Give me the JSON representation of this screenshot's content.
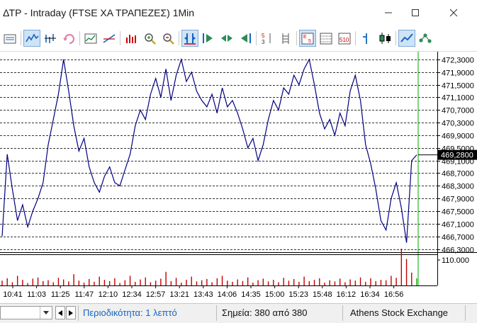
{
  "window": {
    "title": "ΔΤΡ - Intraday (FTSE ΧΑ ΤΡΑΠΕΖΕΣ) 1Min",
    "controls": [
      "minimize-icon",
      "maximize-icon",
      "close-icon"
    ]
  },
  "toolbar": {
    "buttons": [
      {
        "icon": "properties-icon",
        "selected": false
      },
      {
        "icon": "line-chart-icon",
        "selected": true
      },
      {
        "icon": "bar-chart-icon",
        "selected": false
      },
      {
        "icon": "refresh-icon",
        "selected": false
      },
      {
        "icon": "indicator-icon",
        "selected": false
      },
      {
        "icon": "trend-tool-icon",
        "selected": false
      },
      {
        "icon": "volume-bars-icon",
        "selected": false
      },
      {
        "icon": "zoom-in-icon",
        "selected": false
      },
      {
        "icon": "zoom-out-icon",
        "selected": false
      },
      {
        "icon": "fit-icon",
        "selected": true
      },
      {
        "icon": "scroll-end-icon",
        "selected": false
      },
      {
        "icon": "scroll-both-icon",
        "selected": false
      },
      {
        "icon": "scroll-start-icon",
        "selected": false
      },
      {
        "icon": "sort-descending-icon",
        "selected": false
      },
      {
        "icon": "ladder-icon",
        "selected": false
      },
      {
        "icon": "e5-grid-icon",
        "selected": true
      },
      {
        "icon": "dense-grid-icon",
        "selected": false
      },
      {
        "icon": "grid-510-icon",
        "selected": false
      },
      {
        "icon": "tick-bar-icon",
        "selected": false
      },
      {
        "icon": "candlestick-icon",
        "selected": false
      },
      {
        "icon": "line-mode-icon",
        "selected": true
      },
      {
        "icon": "network-icon",
        "selected": false
      }
    ],
    "accent": "#1565c0"
  },
  "chart_data": {
    "type": "line",
    "series": [
      {
        "color": "#000080",
        "values": [
          466.7,
          469.3,
          468.2,
          467.2,
          467.7,
          467.0,
          467.5,
          467.9,
          468.4,
          469.6,
          470.4,
          471.2,
          472.3,
          471.3,
          470.2,
          469.4,
          469.8,
          468.9,
          468.4,
          468.1,
          468.6,
          468.9,
          468.4,
          468.3,
          468.8,
          469.3,
          470.2,
          470.7,
          470.4,
          471.2,
          471.7,
          471.1,
          472.0,
          471.0,
          471.8,
          472.3,
          471.6,
          471.9,
          471.3,
          471.0,
          470.8,
          471.2,
          470.6,
          471.4,
          470.8,
          471.0,
          470.6,
          470.1,
          469.5,
          469.8,
          469.1,
          469.6,
          470.4,
          471.0,
          470.7,
          471.4,
          471.2,
          471.8,
          471.5,
          472.0,
          472.3,
          471.5,
          470.6,
          470.1,
          470.4,
          469.9,
          470.6,
          470.2,
          471.3,
          471.8,
          471.0,
          469.6,
          469.0,
          468.2,
          467.2,
          466.9,
          467.9,
          468.4,
          467.6,
          466.5,
          469.1,
          469.28
        ]
      }
    ],
    "x_tick_labels": [
      "10:41",
      "11:03",
      "11:25",
      "11:47",
      "12:10",
      "12:34",
      "12:57",
      "13:21",
      "13:43",
      "14:06",
      "14:35",
      "15:00",
      "15:23",
      "15:48",
      "16:12",
      "16:34",
      "16:56"
    ],
    "y_tick_labels": [
      "472,3000",
      "471,9000",
      "471,5000",
      "471,1000",
      "470,7000",
      "470,3000",
      "469,9000",
      "469,5000",
      "469,1000",
      "468,7000",
      "468,3000",
      "467,9000",
      "467,5000",
      "467,1000",
      "466,7000",
      "466,3000"
    ],
    "ylim": [
      466.2,
      472.5
    ],
    "last_value_label": "469,2800",
    "last_value": 469.28,
    "volume": {
      "tick_label": "110.000",
      "tick_value": 110000,
      "values": [
        60,
        90,
        40,
        120,
        70,
        30,
        85,
        100,
        55,
        65,
        40,
        95,
        75,
        50,
        140,
        60,
        35,
        80,
        45,
        110,
        70,
        55,
        90,
        30,
        65,
        120,
        45,
        75,
        100,
        40,
        60,
        85,
        170,
        55,
        95,
        35,
        70,
        110,
        50,
        65,
        80,
        40,
        90,
        120,
        60,
        45,
        75,
        55,
        100,
        35,
        65,
        85,
        50,
        70,
        40,
        95,
        60,
        80,
        45,
        110,
        55,
        70,
        90,
        35,
        65,
        50,
        85,
        40,
        75,
        60,
        100,
        45,
        90,
        55,
        70,
        65,
        120,
        95,
        600,
        330,
        160,
        90
      ],
      "color": "#c00000",
      "last_color": "#00aa00"
    },
    "cursor_color": "#00aa00",
    "grid": true
  },
  "status": {
    "period_label": "Περιοδικότητα: 1 λεπτό",
    "points_label": "Σημεία: 380 από 380",
    "exchange_label": "Athens Stock Exchange"
  }
}
